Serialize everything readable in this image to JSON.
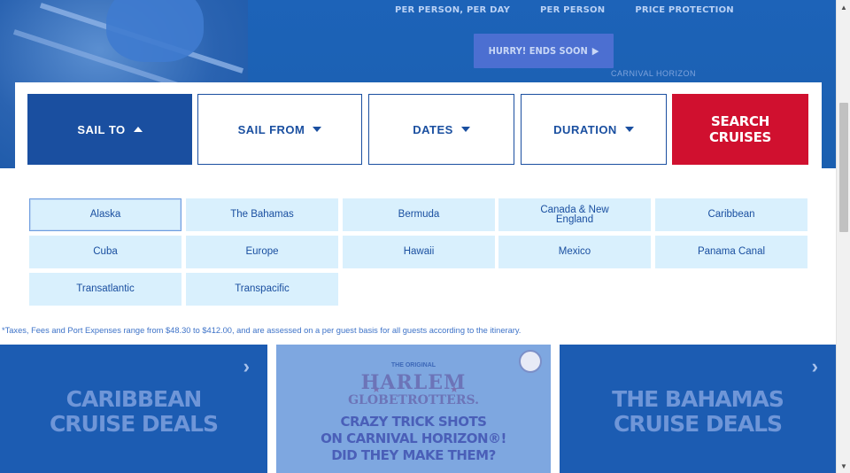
{
  "hero": {
    "stats": [
      "PER PERSON, PER DAY",
      "PER PERSON",
      "PRICE PROTECTION"
    ],
    "cta_label": "HURRY! ENDS SOON",
    "ship_label": "CARNIVAL HORIZON"
  },
  "search": {
    "tabs": [
      {
        "label": "SAIL TO",
        "state": "open"
      },
      {
        "label": "SAIL FROM",
        "state": "closed"
      },
      {
        "label": "DATES",
        "state": "closed"
      },
      {
        "label": "DURATION",
        "state": "closed"
      }
    ],
    "search_button": [
      "SEARCH",
      "CRUISES"
    ],
    "destinations": [
      "Alaska",
      "The Bahamas",
      "Bermuda",
      "Canada & New England",
      "Caribbean",
      "Cuba",
      "Europe",
      "Hawaii",
      "Mexico",
      "Panama Canal",
      "Transatlantic",
      "Transpacific"
    ],
    "selected_destination": "Alaska"
  },
  "footer_note": "*Taxes, Fees and Port Expenses range from $48.30 to $412.00, and are assessed on a per guest basis for all guests according to the itinerary.",
  "promos": {
    "left": [
      "CARIBBEAN",
      "CRUISE DEALS"
    ],
    "middle": {
      "org": "THE ORIGINAL",
      "brand_top": "HARLEM",
      "brand_bottom": "GLOBETROTTERS.",
      "lines": [
        "CRAZY TRICK SHOTS",
        "ON CARNIVAL HORIZON®!",
        "DID THEY MAKE THEM?"
      ]
    },
    "right": [
      "THE BAHAMAS",
      "CRUISE DEALS"
    ]
  },
  "colors": {
    "brand_blue": "#1a4fa0",
    "search_red": "#d0102f",
    "destination_bg": "#d9f0fd",
    "hero_blue": "#1d63b8"
  },
  "icons": {
    "tab_open": "triangle-up-icon",
    "tab_closed": "triangle-down-icon",
    "cta_arrow": "play-arrow-icon",
    "promo_arrow": "chevron-right-icon"
  }
}
